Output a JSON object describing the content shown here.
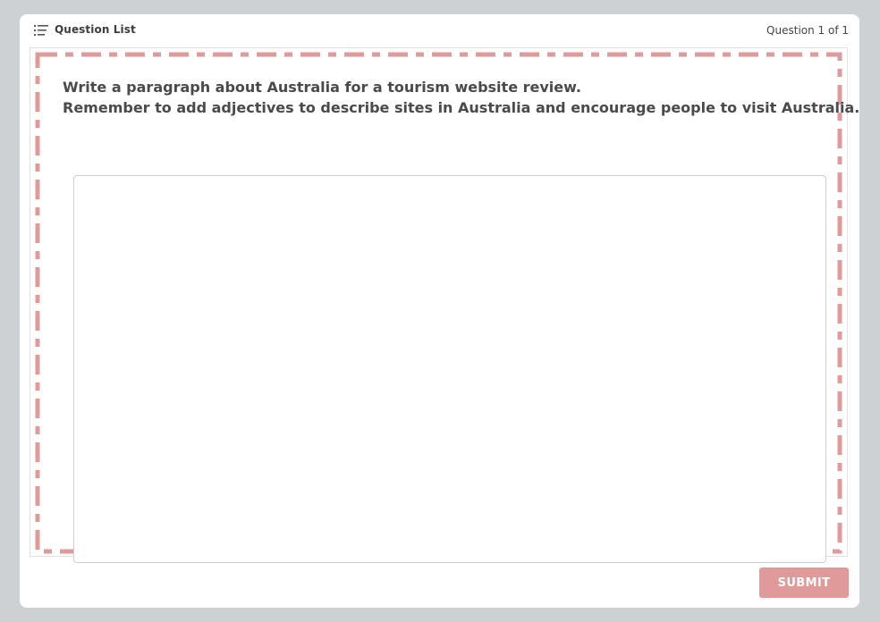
{
  "header": {
    "question_list_label": "Question List",
    "question_counter": "Question 1 of 1"
  },
  "question": {
    "prompt_line_1": "Write a paragraph about Australia for a tourism website review.",
    "prompt_line_2": "Remember to add adjectives to describe sites in Australia and encourage people to visit Australia.",
    "answer_value": ""
  },
  "footer": {
    "submit_label": "SUBMIT"
  },
  "colors": {
    "background": "#ced1d4",
    "accent_dashed": "#e09a9a",
    "submit_bg": "#e09a9a",
    "text": "#4a4a4a"
  },
  "icons": {
    "question_list": "list-icon"
  }
}
